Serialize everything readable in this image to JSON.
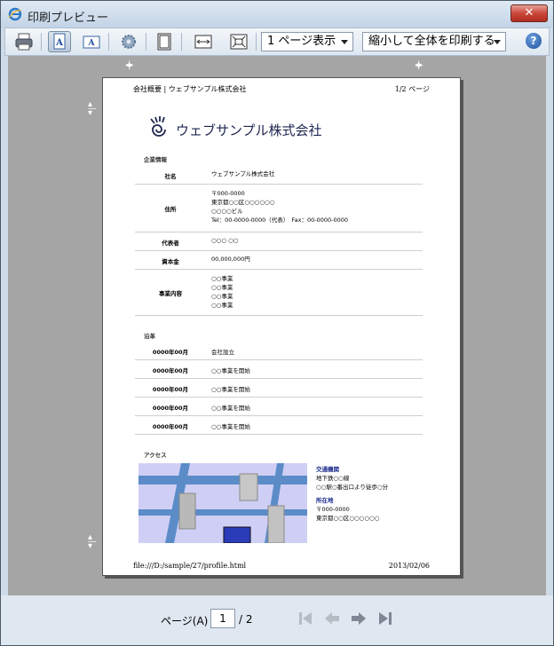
{
  "window": {
    "title": "印刷プレビュー",
    "close_label": "✕"
  },
  "toolbar": {
    "page_view_value": "1 ページ表示",
    "scale_value": "縮小して全体を印刷する",
    "help_label": "?"
  },
  "page": {
    "header_left": "会社概要 | ウェブサンプル株式会社",
    "header_right": "1/2 ページ",
    "company_name": "ウェブサンプル株式会社",
    "footer_left": "file:///D:/sample/27/profile.html",
    "footer_right": "2013/02/06",
    "company_info": {
      "title": "企業情報",
      "rows": [
        {
          "label": "社名",
          "lines": [
            "ウェブサンプル株式会社"
          ]
        },
        {
          "label": "住所",
          "lines": [
            "〒000-0000",
            "東京都○○区○○○○○○",
            "○○○○ビル",
            "Tel：00-0000-0000（代表）　Fax：00-0000-0000"
          ]
        },
        {
          "label": "代表者",
          "lines": [
            "○○○ ○○"
          ]
        },
        {
          "label": "資本金",
          "lines": [
            "00,000,000円"
          ]
        },
        {
          "label": "事業内容",
          "lines": [
            "○○事業",
            "○○事業",
            "○○事業",
            "○○事業"
          ]
        }
      ]
    },
    "history": {
      "title": "沿革",
      "rows": [
        {
          "date": "0000年00月",
          "event": "会社設立"
        },
        {
          "date": "0000年00月",
          "event": "○○事業を開始"
        },
        {
          "date": "0000年00月",
          "event": "○○事業を開始"
        },
        {
          "date": "0000年00月",
          "event": "○○事業を開始"
        },
        {
          "date": "0000年00月",
          "event": "○○事業を開始"
        }
      ]
    },
    "access": {
      "title": "アクセス",
      "transport_head": "交通機関",
      "transport_lines": [
        "地下鉄○○線",
        "○○駅○番出口より徒歩○分"
      ],
      "location_head": "所在地",
      "location_lines": [
        "〒000-0000",
        "東京都○○区○○○○○○"
      ]
    }
  },
  "navigation": {
    "page_label": "ページ(A)",
    "current_page": "1",
    "total_pages": "/ 2"
  }
}
